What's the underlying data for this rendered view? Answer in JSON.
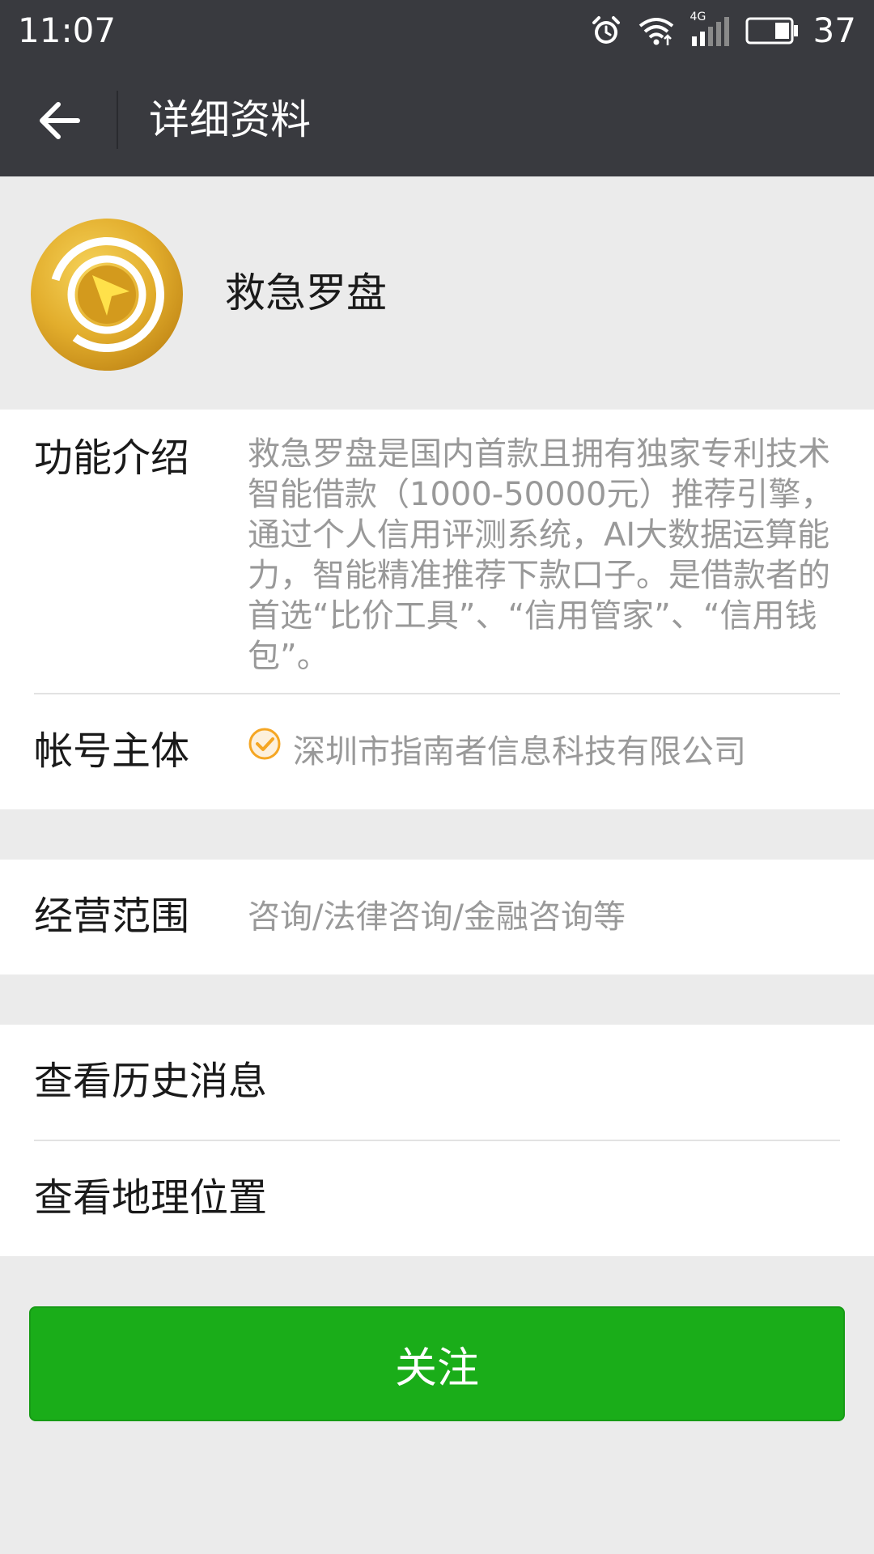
{
  "status_bar": {
    "time": "11:07",
    "network": "4G",
    "battery_percent": "37",
    "icons": [
      "alarm-icon",
      "wifi-icon",
      "signal-icon",
      "battery-icon"
    ]
  },
  "title_bar": {
    "back_icon": "arrow-left-icon",
    "title": "详细资料"
  },
  "profile": {
    "name": "救急罗盘",
    "avatar_icon": "compass-logo"
  },
  "details": {
    "intro_label": "功能介绍",
    "intro_text": "救急罗盘是国内首款且拥有独家专利技术智能借款（1000-50000元）推荐引擎，通过个人信用评测系统，AI大数据运算能力，智能精准推荐下款口子。是借款者的首选“比价工具”、“信用管家”、“信用钱包”。",
    "entity_label": "帐号主体",
    "entity_value": "深圳市指南者信息科技有限公司",
    "verified_icon": "verified-check-icon"
  },
  "business": {
    "label": "经营范围",
    "value": "咨询/法律咨询/金融咨询等"
  },
  "actions": {
    "history": "查看历史消息",
    "location": "查看地理位置"
  },
  "follow_button": "关注",
  "colors": {
    "header_bg": "#393a3f",
    "page_bg": "#ebebeb",
    "follow_green": "#1aad19",
    "verified_orange": "#f5a623"
  }
}
